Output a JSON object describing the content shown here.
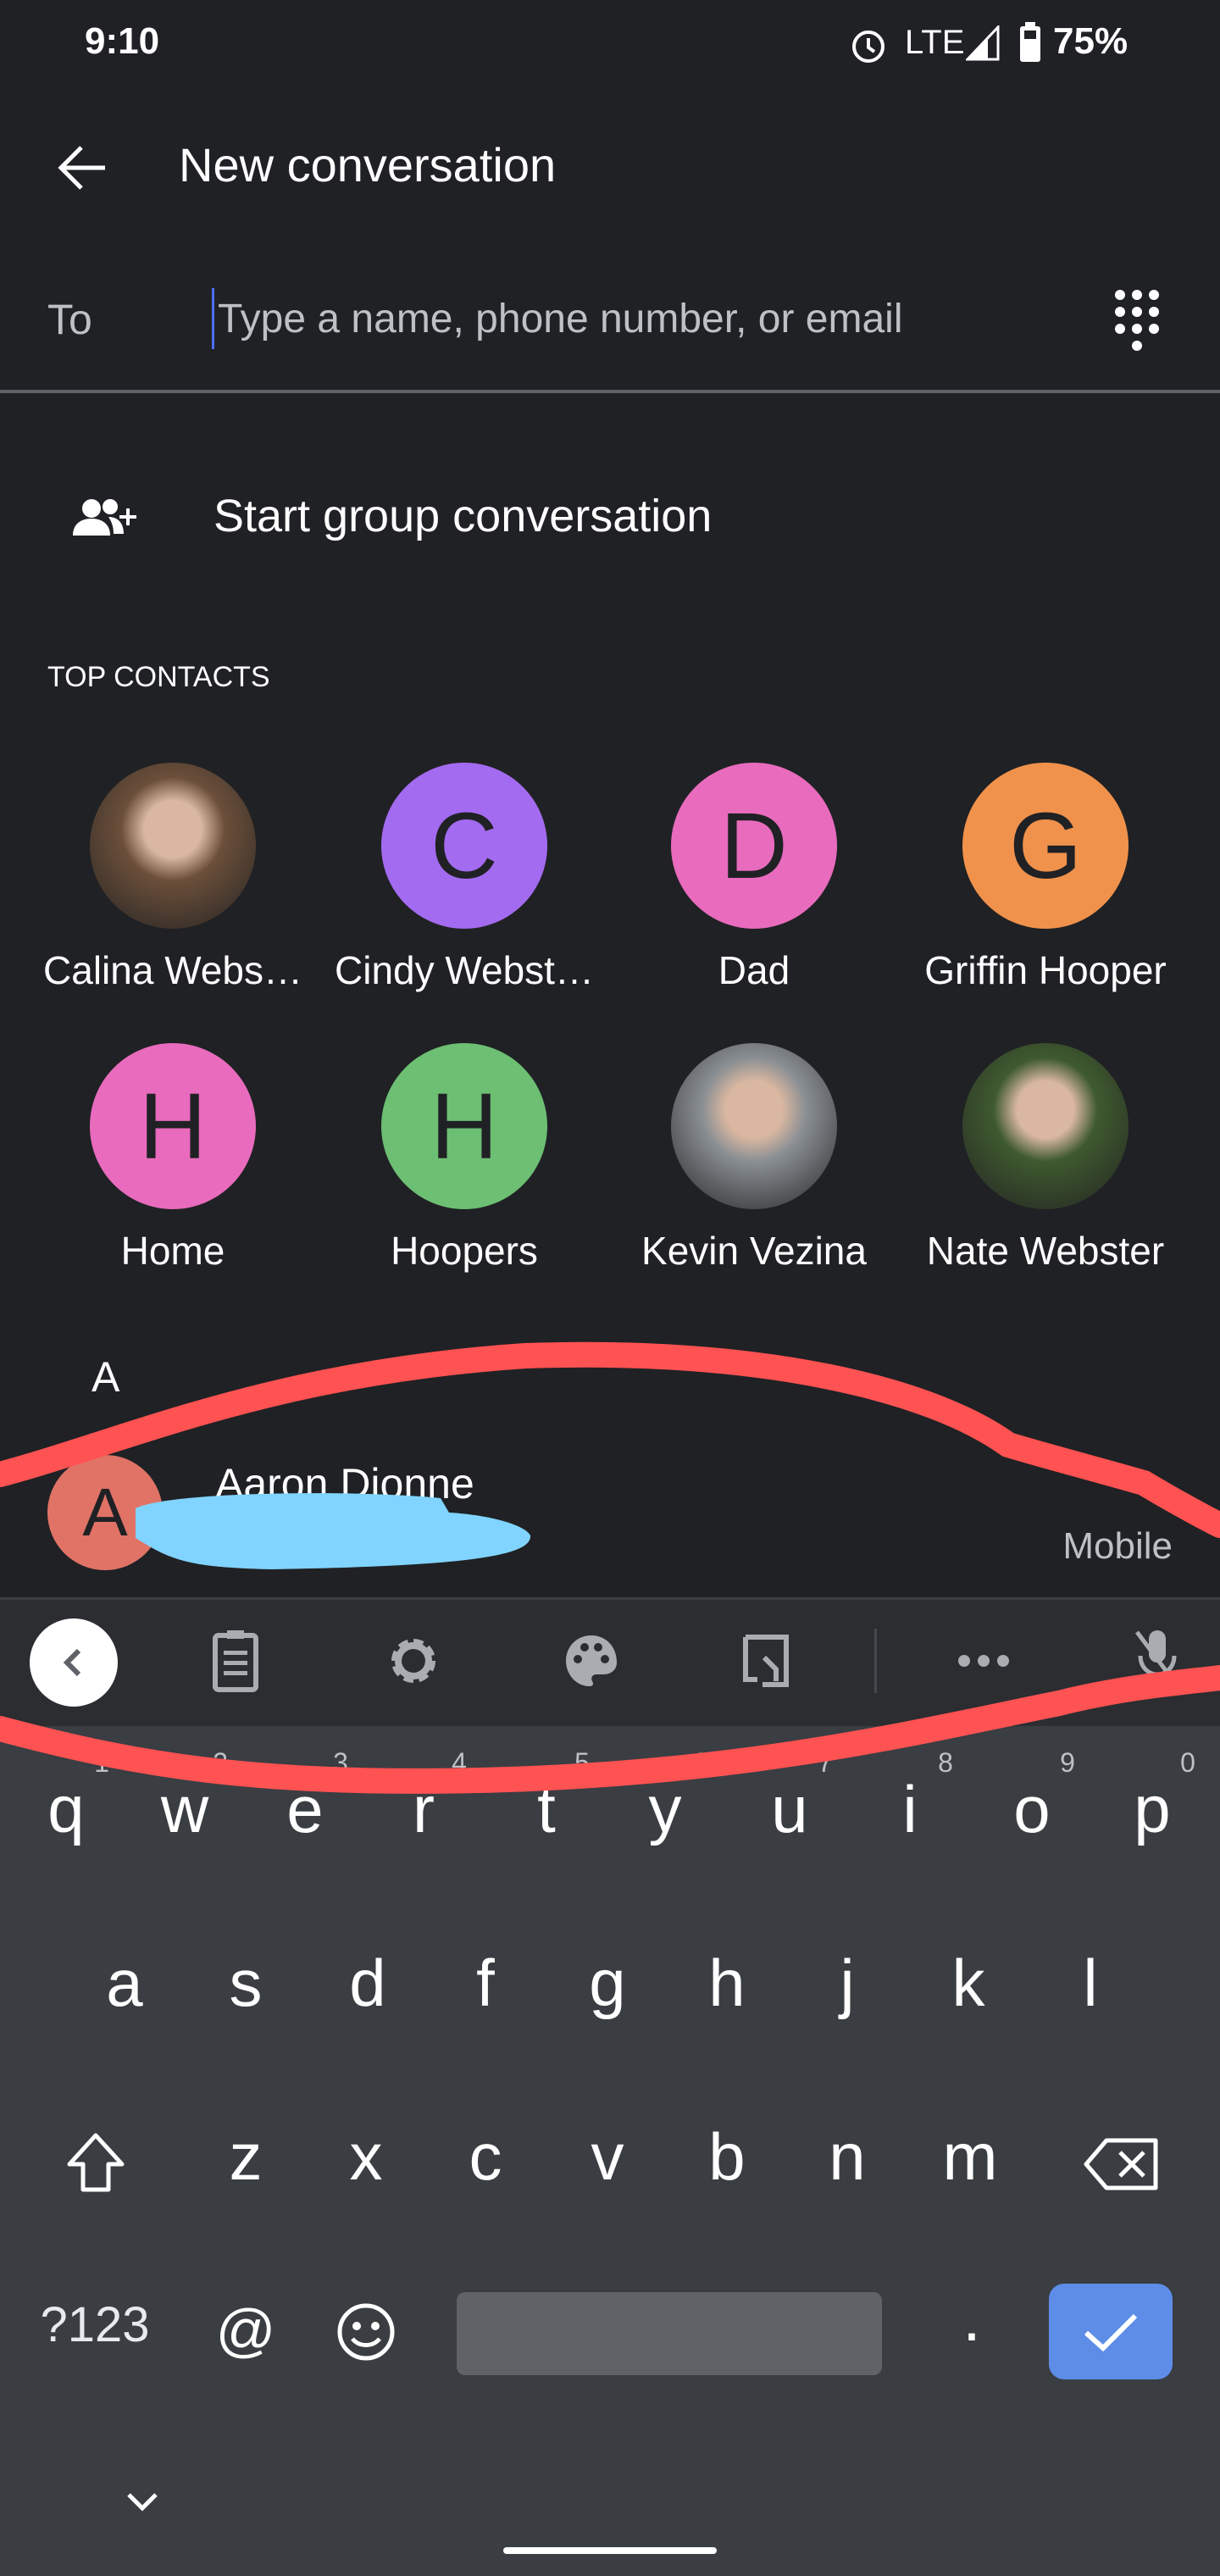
{
  "status": {
    "time": "9:10",
    "network": "LTE",
    "battery": "75%"
  },
  "header": {
    "title": "New conversation",
    "back_icon": "arrow-left-icon"
  },
  "to_field": {
    "label": "To",
    "placeholder": "Type a name, phone number, or email",
    "value": ""
  },
  "group": {
    "label": "Start group conversation"
  },
  "top_contacts": {
    "heading": "TOP CONTACTS",
    "items": [
      {
        "name": "Calina Webs…",
        "initial": "",
        "color": "#6b4f3a"
      },
      {
        "name": "Cindy Webst…",
        "initial": "C",
        "color": "#a36bf0"
      },
      {
        "name": "Dad",
        "initial": "D",
        "color": "#e86bbd"
      },
      {
        "name": "Griffin Hooper",
        "initial": "G",
        "color": "#f0924c"
      },
      {
        "name": "Home",
        "initial": "H",
        "color": "#e86bbd"
      },
      {
        "name": "Hoopers",
        "initial": "H",
        "color": "#6cbf73"
      },
      {
        "name": "Kevin Vezina",
        "initial": "",
        "color": "#8a8f94"
      },
      {
        "name": "Nate Webster",
        "initial": "",
        "color": "#3f5a2f"
      }
    ]
  },
  "list": {
    "section": "A",
    "items": [
      {
        "name": "Aaron Dionne",
        "initial": "A",
        "type": "Mobile",
        "color": "#e07366"
      }
    ]
  },
  "keyboard": {
    "row1": [
      "q",
      "w",
      "e",
      "r",
      "t",
      "y",
      "u",
      "i",
      "o",
      "p"
    ],
    "hints": [
      "1",
      "2",
      "3",
      "4",
      "5",
      "6",
      "7",
      "8",
      "9",
      "0"
    ],
    "row2": [
      "a",
      "s",
      "d",
      "f",
      "g",
      "h",
      "j",
      "k",
      "l"
    ],
    "row3": [
      "z",
      "x",
      "c",
      "v",
      "b",
      "n",
      "m"
    ],
    "symbols": "?123",
    "at": "@",
    "period": ".",
    "enter_color": "#5e8de8"
  },
  "annotation_color": "#ff5252",
  "redaction_color": "#80d4ff"
}
